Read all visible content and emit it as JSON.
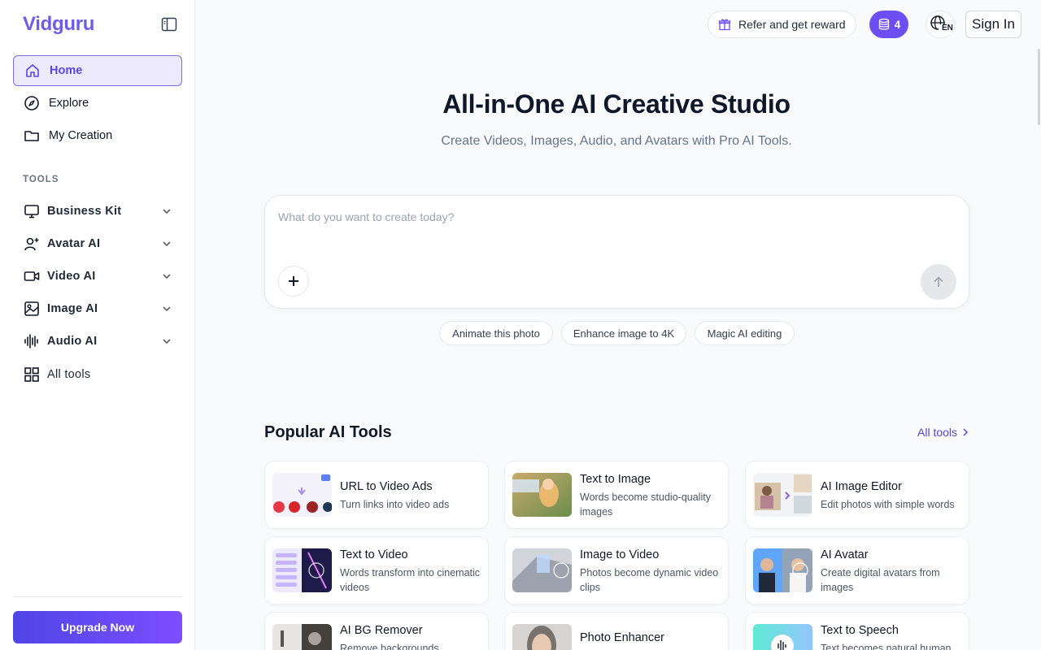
{
  "sidebar": {
    "brand": "Vidguru",
    "nav": [
      {
        "label": "Home",
        "icon": "home-icon",
        "active": true
      },
      {
        "label": "Explore",
        "icon": "compass-icon"
      },
      {
        "label": "My Creation",
        "icon": "folder-icon"
      }
    ],
    "tools_label": "TOOLS",
    "tools": [
      {
        "label": "Business Kit",
        "icon": "monitor-icon"
      },
      {
        "label": "Avatar AI",
        "icon": "user-plus-icon"
      },
      {
        "label": "Video AI",
        "icon": "video-camera-icon"
      },
      {
        "label": "Image AI",
        "icon": "image-icon"
      },
      {
        "label": "Audio AI",
        "icon": "audio-wave-icon"
      },
      {
        "label": "All tools",
        "icon": "grid-icon"
      }
    ],
    "upgrade_label": "Upgrade Now"
  },
  "header": {
    "refer_label": "Refer and get reward",
    "credits": "4",
    "language": "EN",
    "signin_label": "Sign In"
  },
  "hero": {
    "title": "All-in-One AI Creative Studio",
    "subtitle": "Create Videos, Images, Audio, and Avatars with Pro AI Tools.",
    "prompt_placeholder": "What do you want to create today?",
    "prompt_value": "",
    "chips": [
      "Animate this photo",
      "Enhance image to 4K",
      "Magic AI editing"
    ]
  },
  "popular": {
    "title": "Popular AI Tools",
    "all_tools_label": "All tools",
    "cards": [
      {
        "title": "URL to Video Ads",
        "desc": "Turn links into video ads"
      },
      {
        "title": "Text to Image",
        "desc": "Words become studio-quality images"
      },
      {
        "title": "AI Image Editor",
        "desc": "Edit photos with simple words"
      },
      {
        "title": "Text to Video",
        "desc": "Words transform into cinematic videos"
      },
      {
        "title": "Image to Video",
        "desc": "Photos become dynamic video clips"
      },
      {
        "title": "AI Avatar",
        "desc": "Create digital avatars from images"
      },
      {
        "title": "AI BG Remover",
        "desc": "Remove backgrounds"
      },
      {
        "title": "Photo Enhancer",
        "desc": ""
      },
      {
        "title": "Text to Speech",
        "desc": "Text becomes natural human"
      }
    ]
  },
  "colors": {
    "brand": "#6d5ce8",
    "accent": "#6d4ef5",
    "active_bg": "#eeeafe"
  }
}
